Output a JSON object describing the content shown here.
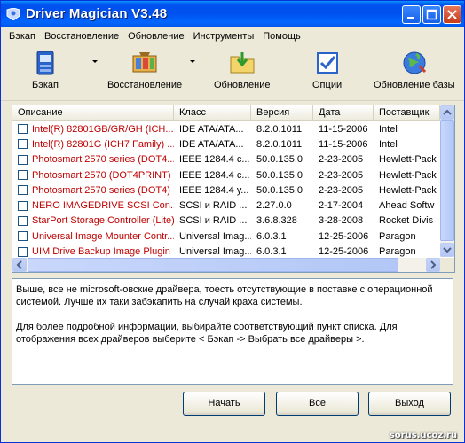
{
  "window": {
    "title": "Driver Magician V3.48",
    "controls": [
      "minimize",
      "maximize",
      "close"
    ]
  },
  "menu": [
    "Бэкап",
    "Восстановление",
    "Обновление",
    "Инструменты",
    "Помощь"
  ],
  "toolbar": {
    "backup_label": "Бэкап",
    "restore_label": "Восстановление",
    "update_label": "Обновление",
    "options_label": "Опции",
    "update_db_label": "Обновление базы"
  },
  "table": {
    "headers": [
      "Описание",
      "Класс",
      "Версия",
      "Дата",
      "Поставщик"
    ],
    "rows": [
      [
        "Intel(R) 82801GB/GR/GH (ICH...",
        "IDE ATA/ATA...",
        "8.2.0.1011",
        "11-15-2006",
        "Intel"
      ],
      [
        "Intel(R) 82801G (ICH7 Family) ...",
        "IDE ATA/ATA...",
        "8.2.0.1011",
        "11-15-2006",
        "Intel"
      ],
      [
        "Photosmart 2570 series (DOT4...",
        "IEEE 1284.4 с...",
        "50.0.135.0",
        "2-23-2005",
        "Hewlett-Pack"
      ],
      [
        "Photosmart 2570 (DOT4PRINT)",
        "IEEE 1284.4 с...",
        "50.0.135.0",
        "2-23-2005",
        "Hewlett-Pack"
      ],
      [
        "Photosmart 2570 series (DOT4)",
        "IEEE 1284.4 у...",
        "50.0.135.0",
        "2-23-2005",
        "Hewlett-Pack"
      ],
      [
        "NERO IMAGEDRIVE SCSI Con...",
        "SCSI и RAID ...",
        "2.27.0.0",
        "2-17-2004",
        "Ahead Softw"
      ],
      [
        "StarPort Storage Controller (Lite)",
        "SCSI и RAID ...",
        "3.6.8.328",
        "3-28-2008",
        "Rocket Divis"
      ],
      [
        "Universal Image Mounter Contr...",
        "Universal Imag...",
        "6.0.3.1",
        "12-25-2006",
        "Paragon"
      ],
      [
        "UIM Drive Backup Image Plugin",
        "Universal Imag...",
        "6.0.3.1",
        "12-25-2006",
        "Paragon"
      ]
    ],
    "row_text_color": "#c00000"
  },
  "description": {
    "paragraph1": "Выше, все не microsoft-овские драйвера, тоесть отсутствующие в поставке с операционной системой. Лучше их таки забэкапить на случай краха системы.",
    "paragraph2": "Для более подробной информации, выбирайте соответствующий пункт списка. Для отображения всех драйверов выберите < Бэкап -> Выбрать все драйверы >."
  },
  "buttons": {
    "start": "Начать",
    "all": "Все",
    "exit": "Выход"
  },
  "watermark": "sorus.ucoz.ru",
  "colors": {
    "titlebar": "#0055e5",
    "window_bg": "#ece9d8",
    "highlight_text": "#c00000"
  }
}
